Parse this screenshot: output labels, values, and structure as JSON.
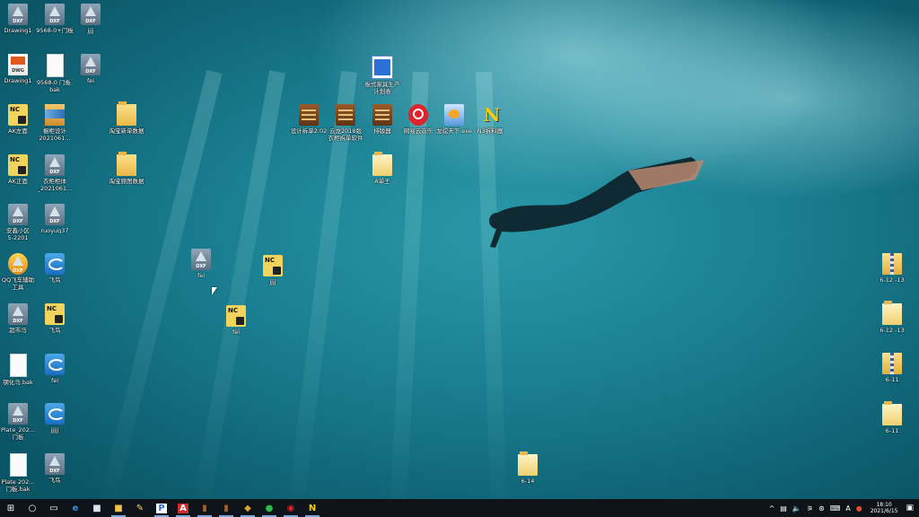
{
  "desktop_icons": [
    {
      "label": "Drawing1",
      "type": "acad"
    },
    {
      "label": "9568-0+门板",
      "type": "acad"
    },
    {
      "label": "jjjj",
      "type": "acad"
    },
    {
      "label": "Drawing1",
      "type": "dwg"
    },
    {
      "label": "9568-0 门板.\nbak",
      "type": "file"
    },
    {
      "label": "fei",
      "type": "acad"
    },
    {
      "label": "AK左面",
      "type": "nc"
    },
    {
      "label": "橱柜设计\n2021061...",
      "type": "winrar"
    },
    {
      "label": "淘宝新单数据",
      "type": "folder"
    },
    {
      "label": "AK正面",
      "type": "nc"
    },
    {
      "label": "衣柜柜体\n_2021061...",
      "type": "acad"
    },
    {
      "label": "淘宝原图数据",
      "type": "folder"
    },
    {
      "label": "安鑫小区\n5-2201",
      "type": "acad"
    },
    {
      "label": "ruoyuq37",
      "type": "acad"
    },
    {
      "label": "QQ飞车辅助\n工具",
      "type": "acad"
    },
    {
      "label": "飞鸟",
      "type": "fly"
    },
    {
      "label": "fei",
      "type": "acad"
    },
    {
      "label": "jjjj",
      "type": "nc"
    },
    {
      "label": "超市马",
      "type": "acad"
    },
    {
      "label": "飞鸟",
      "type": "nc"
    },
    {
      "label": "fei",
      "type": "nc"
    },
    {
      "label": "钢化马.bak",
      "type": "file"
    },
    {
      "label": "fei",
      "type": "fly"
    },
    {
      "label": "Plate_202...\n门板",
      "type": "acad"
    },
    {
      "label": "jjjjj",
      "type": "fly"
    },
    {
      "label": "Plate 202...\n门板.bak",
      "type": "file"
    },
    {
      "label": "飞鸟",
      "type": "acad"
    },
    {
      "label": "设计拆单2.02",
      "type": "bookcase"
    },
    {
      "label": "云龙2018版\n衣柜拆单软件",
      "type": "bookcase"
    },
    {
      "label": "排版器",
      "type": "bookcase"
    },
    {
      "label": "网易云音乐",
      "type": "netease"
    },
    {
      "label": "龙驼天下.exe",
      "type": "ie"
    },
    {
      "label": "N3拆料器",
      "type": "nicon"
    },
    {
      "label": "板式家具生产\n计划表",
      "type": "win"
    },
    {
      "label": "A单王",
      "type": "folder"
    },
    {
      "label": "6-14",
      "type": "folder"
    },
    {
      "label": "6-12 -13",
      "type": "zip"
    },
    {
      "label": "6-12 -13",
      "type": "folder"
    },
    {
      "label": "6-11",
      "type": "zip"
    },
    {
      "label": "6-11",
      "type": "folder"
    }
  ],
  "taskbar": {
    "items": [
      {
        "name": "start",
        "glyph": "⊞"
      },
      {
        "name": "search",
        "glyph": "○"
      },
      {
        "name": "task-view",
        "glyph": "▭"
      },
      {
        "name": "edge",
        "glyph": "e",
        "color": "#3b8fe0"
      },
      {
        "name": "store",
        "glyph": "■",
        "color": "#d9e6f2"
      },
      {
        "name": "file-explorer",
        "glyph": "■",
        "color": "#f2c14e"
      },
      {
        "name": "app-brush",
        "glyph": "✎",
        "color": "#e6d06a"
      },
      {
        "name": "app-p",
        "glyph": "P",
        "color": "#2a6fd1"
      },
      {
        "name": "autocad",
        "glyph": "A",
        "color": "#d12a2a"
      },
      {
        "name": "app-book-1",
        "glyph": "▮",
        "color": "#a0602a"
      },
      {
        "name": "app-book-2",
        "glyph": "▮",
        "color": "#a0602a"
      },
      {
        "name": "app-net",
        "glyph": "◆",
        "color": "#e0a030"
      },
      {
        "name": "wechat",
        "glyph": "●",
        "color": "#2dbb4b"
      },
      {
        "name": "netease-music",
        "glyph": "◉",
        "color": "#e1242a"
      },
      {
        "name": "n3",
        "glyph": "N",
        "color": "#f7d000"
      }
    ],
    "tray": {
      "icons": [
        "^",
        "▤",
        "🔈",
        "⚞",
        "⊛",
        "⌨",
        "A",
        "●"
      ],
      "time": "18:10",
      "date": "2021/6/15"
    }
  }
}
